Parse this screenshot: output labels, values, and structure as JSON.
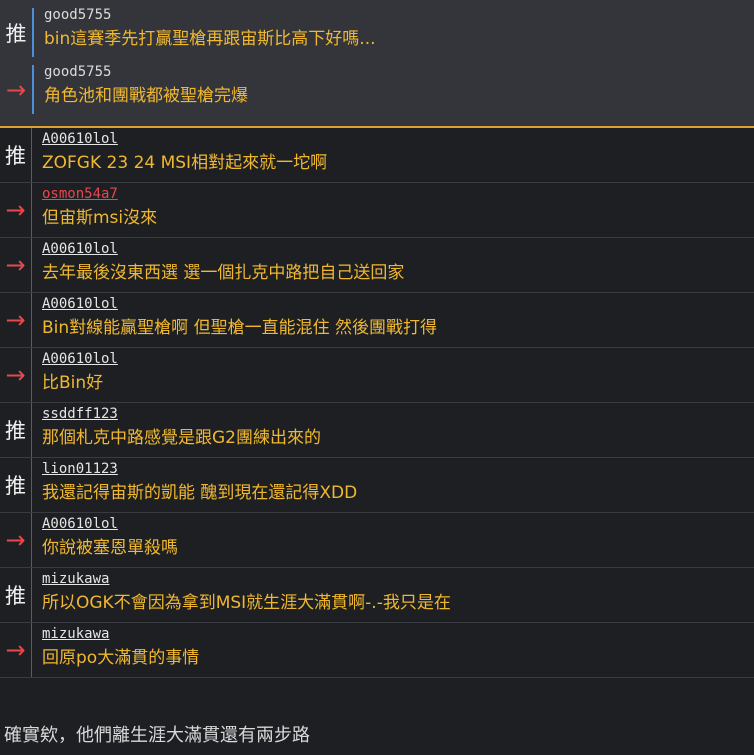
{
  "quoted": [
    {
      "tag": "推",
      "type": "push",
      "author": "good5755",
      "content": "bin這賽季先打贏聖槍再跟宙斯比高下好嗎..."
    },
    {
      "tag": "→",
      "type": "arrow",
      "author": "good5755",
      "content": "角色池和團戰都被聖槍完爆"
    }
  ],
  "comments": [
    {
      "tag": "推",
      "type": "push",
      "author": "A00610lol",
      "content": "ZOFGK 23 24 MSI相對起來就一坨啊",
      "highlight": false
    },
    {
      "tag": "→",
      "type": "arrow",
      "author": "osmon54a7",
      "content": "但宙斯msi沒來",
      "highlight": true
    },
    {
      "tag": "→",
      "type": "arrow",
      "author": "A00610lol",
      "content": "去年最後沒東西選 選一個扎克中路把自己送回家",
      "highlight": false
    },
    {
      "tag": "→",
      "type": "arrow",
      "author": "A00610lol",
      "content": "Bin對線能贏聖槍啊 但聖槍一直能混住 然後團戰打得",
      "highlight": false
    },
    {
      "tag": "→",
      "type": "arrow",
      "author": "A00610lol",
      "content": "比Bin好",
      "highlight": false
    },
    {
      "tag": "推",
      "type": "push",
      "author": "ssddff123",
      "content": "那個札克中路感覺是跟G2團練出來的",
      "highlight": false
    },
    {
      "tag": "推",
      "type": "push",
      "author": "lion01123",
      "content": "我還記得宙斯的凱能 醜到現在還記得XDD",
      "highlight": false
    },
    {
      "tag": "→",
      "type": "arrow",
      "author": "A00610lol",
      "content": "你說被塞恩單殺嗎",
      "highlight": false
    },
    {
      "tag": "推",
      "type": "push",
      "author": "mizukawa",
      "content": "所以OGK不會因為拿到MSI就生涯大滿貫啊-.-我只是在",
      "highlight": false
    },
    {
      "tag": "→",
      "type": "arrow",
      "author": "mizukawa",
      "content": "回原po大滿貫的事情",
      "highlight": false
    }
  ],
  "footer_text": "確實欸，他們離生涯大滿貫還有兩步路"
}
